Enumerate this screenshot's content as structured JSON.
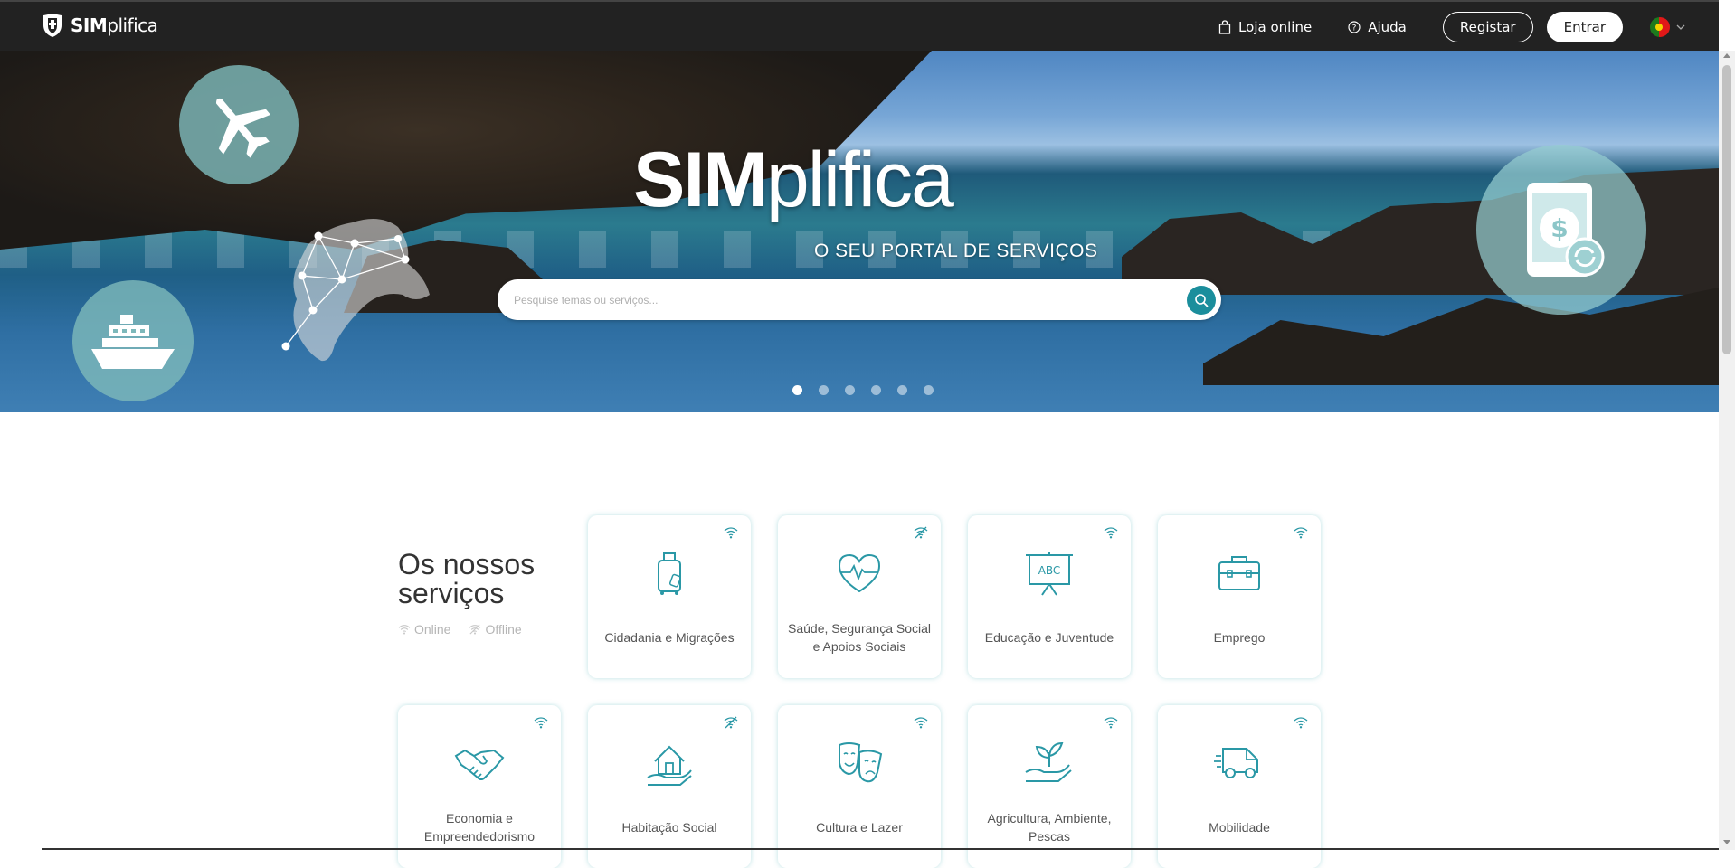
{
  "header": {
    "logo_text_bold": "SIM",
    "logo_text_light": "plifica",
    "shop_label": "Loja online",
    "help_label": "Ajuda",
    "register_label": "Registar",
    "login_label": "Entrar",
    "language_icon": "portugal-flag-icon"
  },
  "hero": {
    "title_bold": "SIM",
    "title_light": "plifica",
    "subtitle": "O SEU PORTAL DE SERVIÇOS",
    "search_placeholder": "Pesquise temas ou serviços...",
    "slides_count": 6,
    "active_slide": 1
  },
  "services": {
    "title_line1": "Os nossos",
    "title_line2": "serviços",
    "legend_online": "Online",
    "legend_offline": "Offline",
    "cards": [
      {
        "label": "Cidadania e Migrações",
        "status": "online",
        "icon": "luggage-icon"
      },
      {
        "label": "Saúde, Segurança Social e Apoios Sociais",
        "status": "offline",
        "icon": "heartbeat-icon"
      },
      {
        "label": "Educação e Juventude",
        "status": "online",
        "icon": "whiteboard-abc-icon"
      },
      {
        "label": "Emprego",
        "status": "online",
        "icon": "briefcase-icon"
      },
      {
        "label": "Economia e Empreendedorismo",
        "status": "online",
        "icon": "handshake-icon"
      },
      {
        "label": "Habitação Social",
        "status": "offline",
        "icon": "house-hand-icon"
      },
      {
        "label": "Cultura e Lazer",
        "status": "online",
        "icon": "theater-masks-icon"
      },
      {
        "label": "Agricultura, Ambiente, Pescas",
        "status": "online",
        "icon": "plant-hand-icon"
      },
      {
        "label": "Mobilidade",
        "status": "online",
        "icon": "van-icon"
      }
    ]
  },
  "colors": {
    "topbar": "#222222",
    "accent": "#1b8e9c",
    "icon_teal": "#2a98a6"
  }
}
